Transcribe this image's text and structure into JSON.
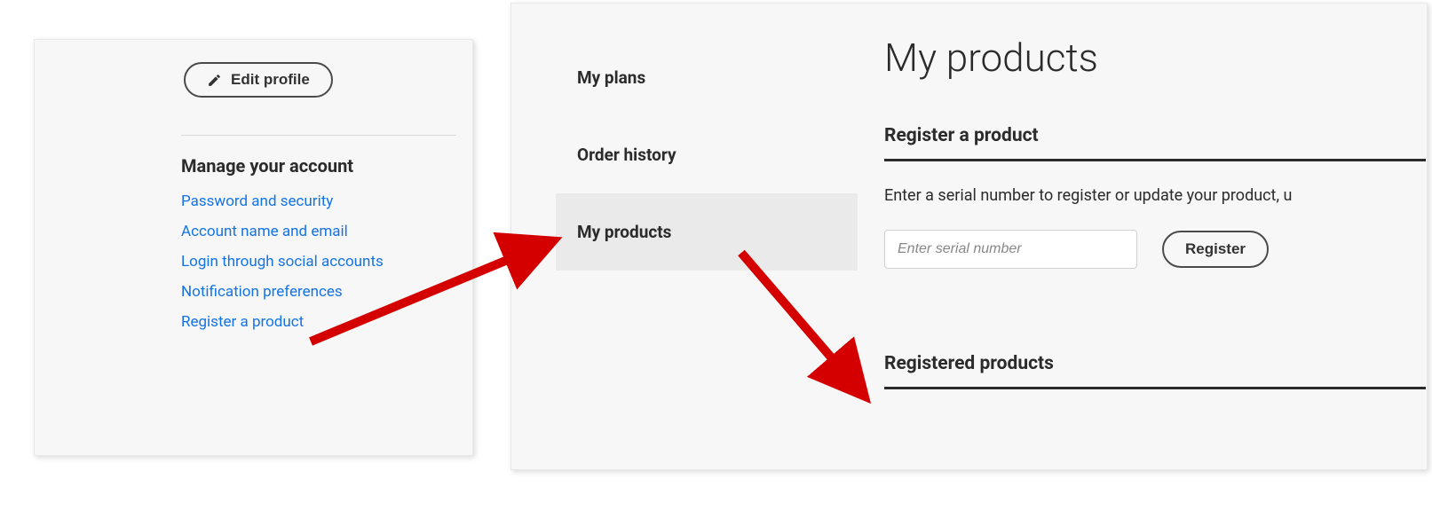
{
  "left_panel": {
    "edit_profile_label": "Edit profile",
    "section_heading": "Manage your account",
    "links": [
      "Password and security",
      "Account name and email",
      "Login through social accounts",
      "Notification preferences",
      "Register a product"
    ]
  },
  "right_panel": {
    "sidebar": {
      "items": [
        {
          "label": "My plans",
          "active": false
        },
        {
          "label": "Order history",
          "active": false
        },
        {
          "label": "My products",
          "active": true
        }
      ]
    },
    "main": {
      "title": "My products",
      "register_heading": "Register a product",
      "register_desc": "Enter a serial number to register or update your product, u",
      "serial_placeholder": "Enter serial number",
      "register_button": "Register",
      "registered_heading": "Registered products"
    }
  }
}
